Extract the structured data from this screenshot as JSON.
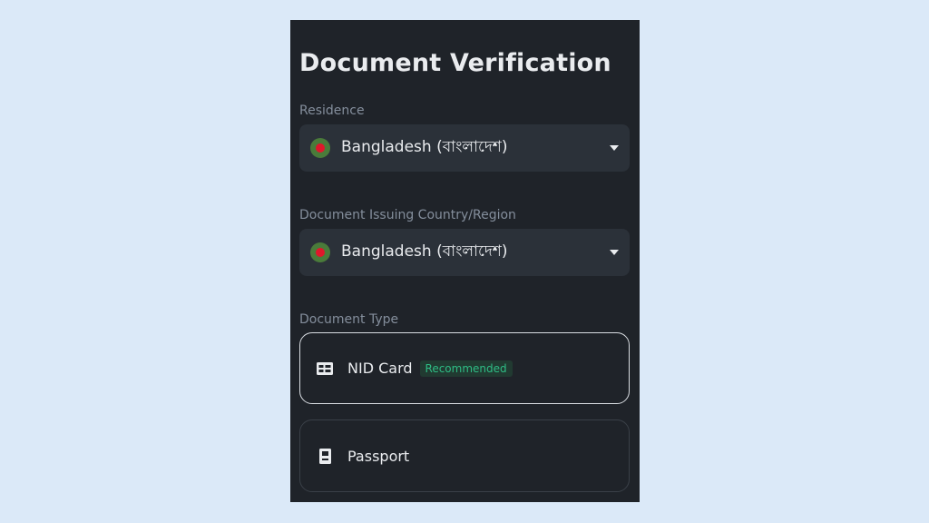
{
  "page": {
    "title": "Document Verification"
  },
  "residence": {
    "label": "Residence",
    "value": "Bangladesh (বাংলাদেশ)",
    "flag_icon": "bangladesh-flag-icon"
  },
  "issuing_country": {
    "label": "Document Issuing Country/Region",
    "value": "Bangladesh (বাংলাদেশ)",
    "flag_icon": "bangladesh-flag-icon"
  },
  "document_type": {
    "label": "Document Type",
    "options": [
      {
        "label": "NID Card",
        "badge": "Recommended",
        "icon": "id-card-icon",
        "selected": true
      },
      {
        "label": "Passport",
        "badge": "",
        "icon": "passport-icon",
        "selected": false
      }
    ]
  },
  "colors": {
    "background": "#1f2329",
    "field": "#2b3139",
    "text": "#eaecef",
    "muted": "#848e9c",
    "accent_green": "#2ebd85",
    "flag_green": "#4a7b3a",
    "flag_red": "#e0172b"
  }
}
